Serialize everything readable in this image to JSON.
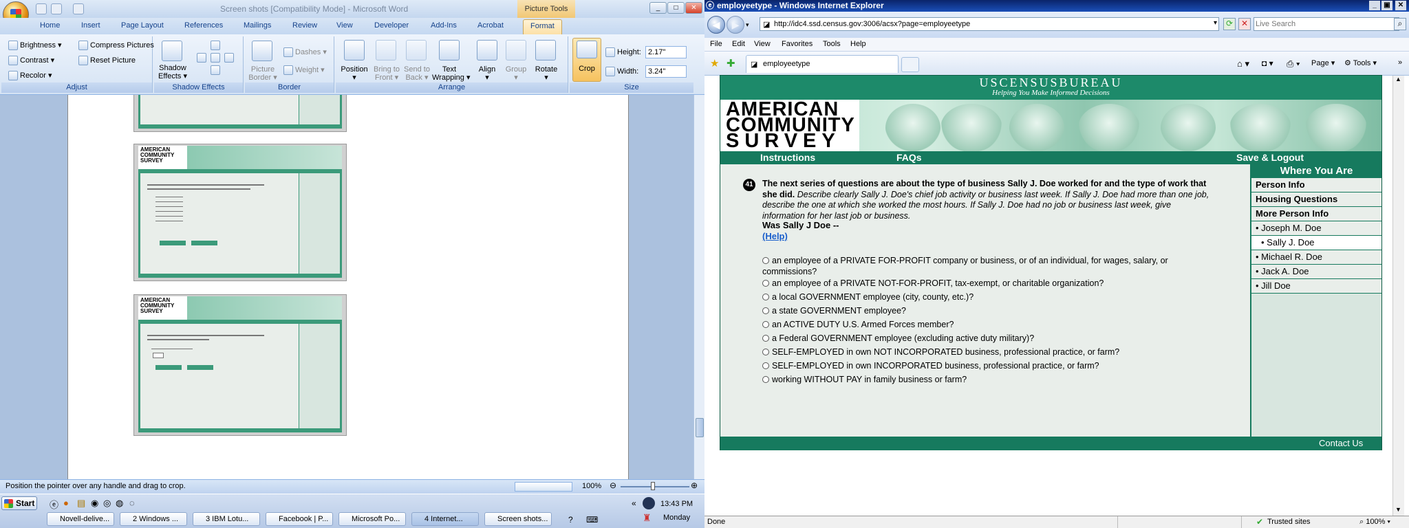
{
  "word": {
    "title": "Screen shots [Compatibility Mode] - Microsoft Word",
    "context_tab": "Picture Tools",
    "tabs": [
      "Home",
      "Insert",
      "Page Layout",
      "References",
      "Mailings",
      "Review",
      "View",
      "Developer",
      "Add-Ins",
      "Acrobat",
      "Format"
    ],
    "adjust": {
      "brightness": "Brightness",
      "compress": "Compress Pictures",
      "contrast": "Contrast",
      "reset": "Reset Picture",
      "recolor": "Recolor",
      "label": "Adjust"
    },
    "shadow": {
      "effects": "Shadow",
      "effects2": "Effects",
      "label": "Shadow Effects"
    },
    "border": {
      "picture_border": "Picture",
      "picture_border2": "Border",
      "dashes": "Dashes",
      "weight": "Weight",
      "label": "Border"
    },
    "arrange": {
      "position": "Position",
      "bring": "Bring to",
      "bring2": "Front",
      "send": "Send to",
      "send2": "Back",
      "wrap": "Text",
      "wrap2": "Wrapping",
      "align": "Align",
      "group": "Group",
      "rotate": "Rotate",
      "label": "Arrange"
    },
    "size": {
      "crop": "Crop",
      "height_label": "Height:",
      "height": "2.17\"",
      "width_label": "Width:",
      "width": "3.24\"",
      "label": "Size"
    },
    "status": "Position the pointer over any handle and drag to crop.",
    "zoom": "100%"
  },
  "ie": {
    "title": "employeetype - Windows Internet Explorer",
    "url": "http://idc4.ssd.census.gov:3006/acsx?page=employeetype",
    "search_placeholder": "Live Search",
    "menu": [
      "File",
      "Edit",
      "View",
      "Favorites",
      "Tools",
      "Help"
    ],
    "tab": "employeetype",
    "cmd": {
      "page": "Page",
      "tools": "Tools"
    },
    "status_left": "Done",
    "status_zone": "Trusted sites",
    "status_zoom": "100%"
  },
  "census": {
    "bureau": "USCENSUSBUREAU",
    "tagline": "Helping You Make Informed Decisions",
    "logo": [
      "AMERICAN",
      "COMMUNITY",
      "SURVEY"
    ],
    "nav": {
      "instructions": "Instructions",
      "faqs": "FAQs",
      "save": "Save & Logout"
    },
    "question_number": "41",
    "question_bold": "The next series of questions are about the type of business Sally J. Doe worked for and the type of work that she did.",
    "question_italic": "Describe clearly Sally J. Doe's chief job activity or business last week. If Sally J. Doe had more than one job, describe the one at which she worked the most hours. If Sally J. Doe had no job or business last week, give information for her last job or business.",
    "prompt": "Was Sally J Doe --",
    "help": "(Help)",
    "options": [
      "an employee of a PRIVATE FOR-PROFIT company or business, or of an individual, for      wages, salary, or commissions?",
      "an employee of a PRIVATE NOT-FOR-PROFIT, tax-exempt, or charitable organization?",
      "a local GOVERNMENT employee (city, county, etc.)?",
      "a state GOVERNMENT employee?",
      "an ACTIVE DUTY U.S. Armed Forces member?",
      "a Federal GOVERNMENT employee (excluding active duty military)?",
      "SELF-EMPLOYED in own NOT INCORPORATED business, professional practice, or farm?",
      "SELF-EMPLOYED in own INCORPORATED business, professional practice, or farm?",
      "working WITHOUT PAY in family business or farm?"
    ],
    "sidebar": {
      "title": "Where You Are",
      "items": [
        "Person Info",
        "Housing Questions",
        "More Person Info"
      ],
      "people": [
        "• Joseph M. Doe",
        "• Sally J. Doe",
        "• Michael R. Doe",
        "• Jack A. Doe",
        "• Jill Doe"
      ]
    },
    "contact": "Contact Us"
  },
  "taskbar": {
    "start": "Start",
    "buttons": [
      "Novell-delive...",
      "2 Windows ...",
      "3 IBM Lotu...",
      "Facebook | P...",
      "Microsoft Po...",
      "4 Internet...",
      "Screen shots..."
    ],
    "time": "13:43 PM",
    "day": "Monday"
  }
}
